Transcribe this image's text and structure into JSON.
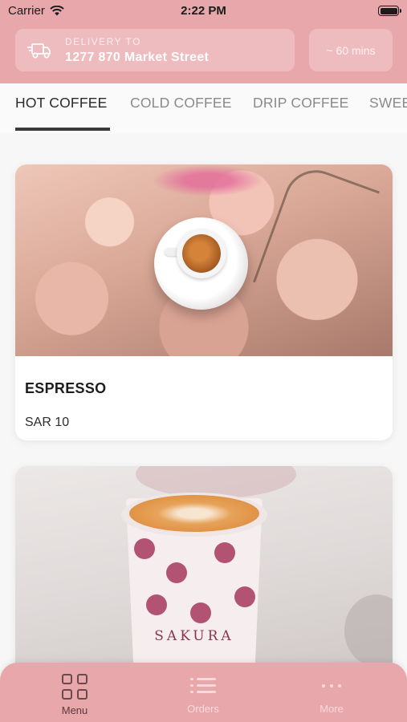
{
  "status_bar": {
    "carrier": "Carrier",
    "time": "2:22 PM"
  },
  "header": {
    "delivery_label": "DELIVERY TO",
    "address": "1277 870 Market Street",
    "eta": "~ 60 mins"
  },
  "tabs": [
    "HOT COFFEE",
    "COLD COFFEE",
    "DRIP COFFEE",
    "SWEE"
  ],
  "active_tab": 0,
  "products": [
    {
      "name": "ESPRESSO",
      "price": "SAR 10"
    },
    {
      "cup_logo": "SAKURA"
    }
  ],
  "bottom_nav": [
    {
      "label": "Menu",
      "icon": "grid-icon",
      "active": true
    },
    {
      "label": "Orders",
      "icon": "list-icon",
      "active": false
    },
    {
      "label": "More",
      "icon": "more-dots-icon",
      "active": false
    }
  ],
  "colors": {
    "brand_pink": "#e8a7ab",
    "card_bg": "#ffffff"
  }
}
